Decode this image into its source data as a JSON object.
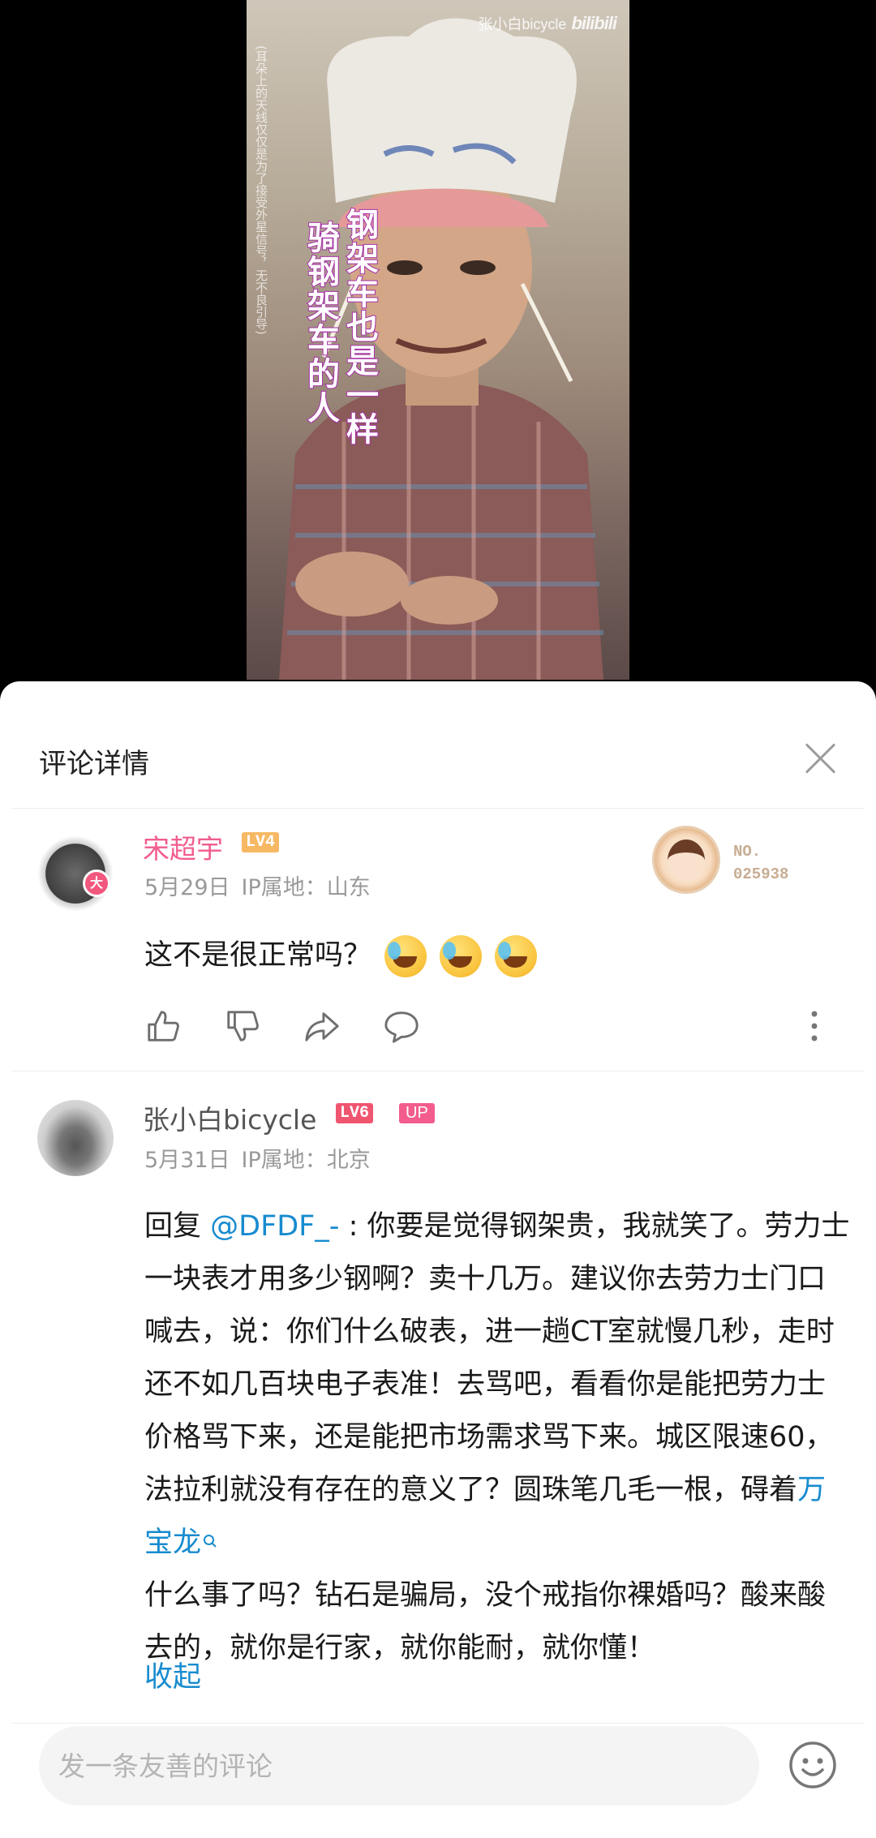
{
  "video": {
    "watermark_channel": "张小白bicycle",
    "watermark_logo": "bilibili",
    "caption_line1": "钢架车也是一样",
    "caption_line2": "骑钢架车的人",
    "caption_note": "(耳朵上的天线仅仅是为了接受外星信号，无不良引导)"
  },
  "panel": {
    "title": "评论详情"
  },
  "comments": [
    {
      "username": "宋超宇",
      "level": "LV4",
      "avatar_badge": "大",
      "date": "5月29日",
      "ip": "IP属地：山东",
      "fan_badge_label": "NO.",
      "fan_badge_number": "025938",
      "text": "这不是很正常吗？",
      "emojis": [
        "crying-laugh",
        "crying-laugh",
        "crying-laugh"
      ],
      "actions": [
        "like-icon",
        "dislike-icon",
        "share-icon",
        "reply-icon",
        "more-icon"
      ]
    },
    {
      "username": "张小白bicycle",
      "level": "LV6",
      "up_badge": "UP",
      "date": "5月31日",
      "ip": "IP属地：北京",
      "reply_prefix": "回复 ",
      "mention": "@DFDF_-",
      "text_before_link": " : 你要是觉得钢架贵，我就笑了。劳力士一块表才用多少钢啊？卖十几万。建议你去劳力士门口喊去，说：你们什么破表，进一趟CT室就慢几秒，走时还不如几百块电子表准！去骂吧，看看你是能把劳力士价格骂下来，还是能把市场需求骂下来。城区限速60，法拉利就没有存在的意义了？圆珠笔几毛一根，碍着",
      "keyword_link": "万宝龙",
      "text_after_link": "什么事了吗？钻石是骗局，没个戒指你裸婚吗？酸来酸去的，就你是行家，就你能耐，就你懂！",
      "collapse_label": "收起"
    }
  ],
  "bottom": {
    "input_placeholder": "发一条友善的评论",
    "emoji_icon": "emoji-face-icon"
  },
  "colors": {
    "username_pink": "#f25d8e",
    "link_blue": "#178bcf",
    "lv4": "#f7b864",
    "lv6": "#f0556f"
  }
}
